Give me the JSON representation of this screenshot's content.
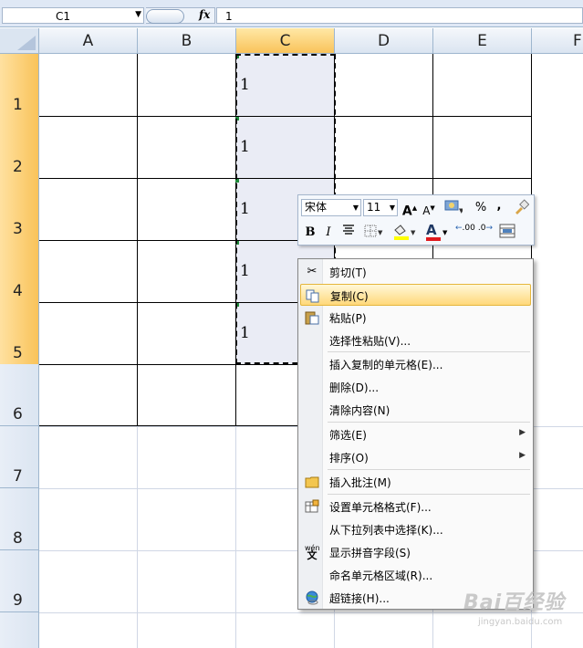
{
  "formula_bar": {
    "name_box": "C1",
    "fx_label": "fx",
    "formula_value": "1"
  },
  "sheet": {
    "columns": [
      "A",
      "B",
      "C",
      "D",
      "E",
      "F"
    ],
    "selected_column": "C",
    "rows": [
      "1",
      "2",
      "3",
      "4",
      "5",
      "6",
      "7",
      "8",
      "9"
    ],
    "selected_rows": [
      "1",
      "2",
      "3",
      "4",
      "5"
    ],
    "column_c_values": [
      "1",
      "1",
      "1",
      "1",
      "1"
    ]
  },
  "mini_toolbar": {
    "font_name": "宋体",
    "font_size": "11",
    "grow_font": "A",
    "shrink_font": "A",
    "percent": "%",
    "comma": ",",
    "bold": "B",
    "italic": "I",
    "font_color": "A",
    "increase_decimal": ".00",
    "decrease_decimal": ".0"
  },
  "context_menu": {
    "items": [
      {
        "label": "剪切(T)",
        "icon": "scissors-icon"
      },
      {
        "label": "复制(C)",
        "icon": "copy-icon",
        "highlighted": true
      },
      {
        "label": "粘贴(P)",
        "icon": "paste-icon"
      },
      {
        "label": "选择性粘贴(V)...",
        "icon": ""
      },
      {
        "label": "插入复制的单元格(E)...",
        "icon": ""
      },
      {
        "label": "删除(D)...",
        "icon": ""
      },
      {
        "label": "清除内容(N)",
        "icon": ""
      },
      {
        "label": "筛选(E)",
        "icon": "",
        "submenu": true
      },
      {
        "label": "排序(O)",
        "icon": "",
        "submenu": true
      },
      {
        "label": "插入批注(M)",
        "icon": "comment-icon"
      },
      {
        "label": "设置单元格格式(F)...",
        "icon": "format-cells-icon"
      },
      {
        "label": "从下拉列表中选择(K)...",
        "icon": ""
      },
      {
        "label": "显示拼音字段(S)",
        "icon": "phonetic-icon"
      },
      {
        "label": "命名单元格区域(R)...",
        "icon": ""
      },
      {
        "label": "超链接(H)...",
        "icon": "hyperlink-icon"
      }
    ]
  },
  "watermark": {
    "main": "Bai百经验",
    "sub": "jingyan.baidu.com"
  },
  "colors": {
    "header_bg": "#dbe5f1",
    "selected_header": "#f9c35a",
    "menu_highlight": "#ffd87a",
    "selection_fill": "#eaecf5"
  }
}
